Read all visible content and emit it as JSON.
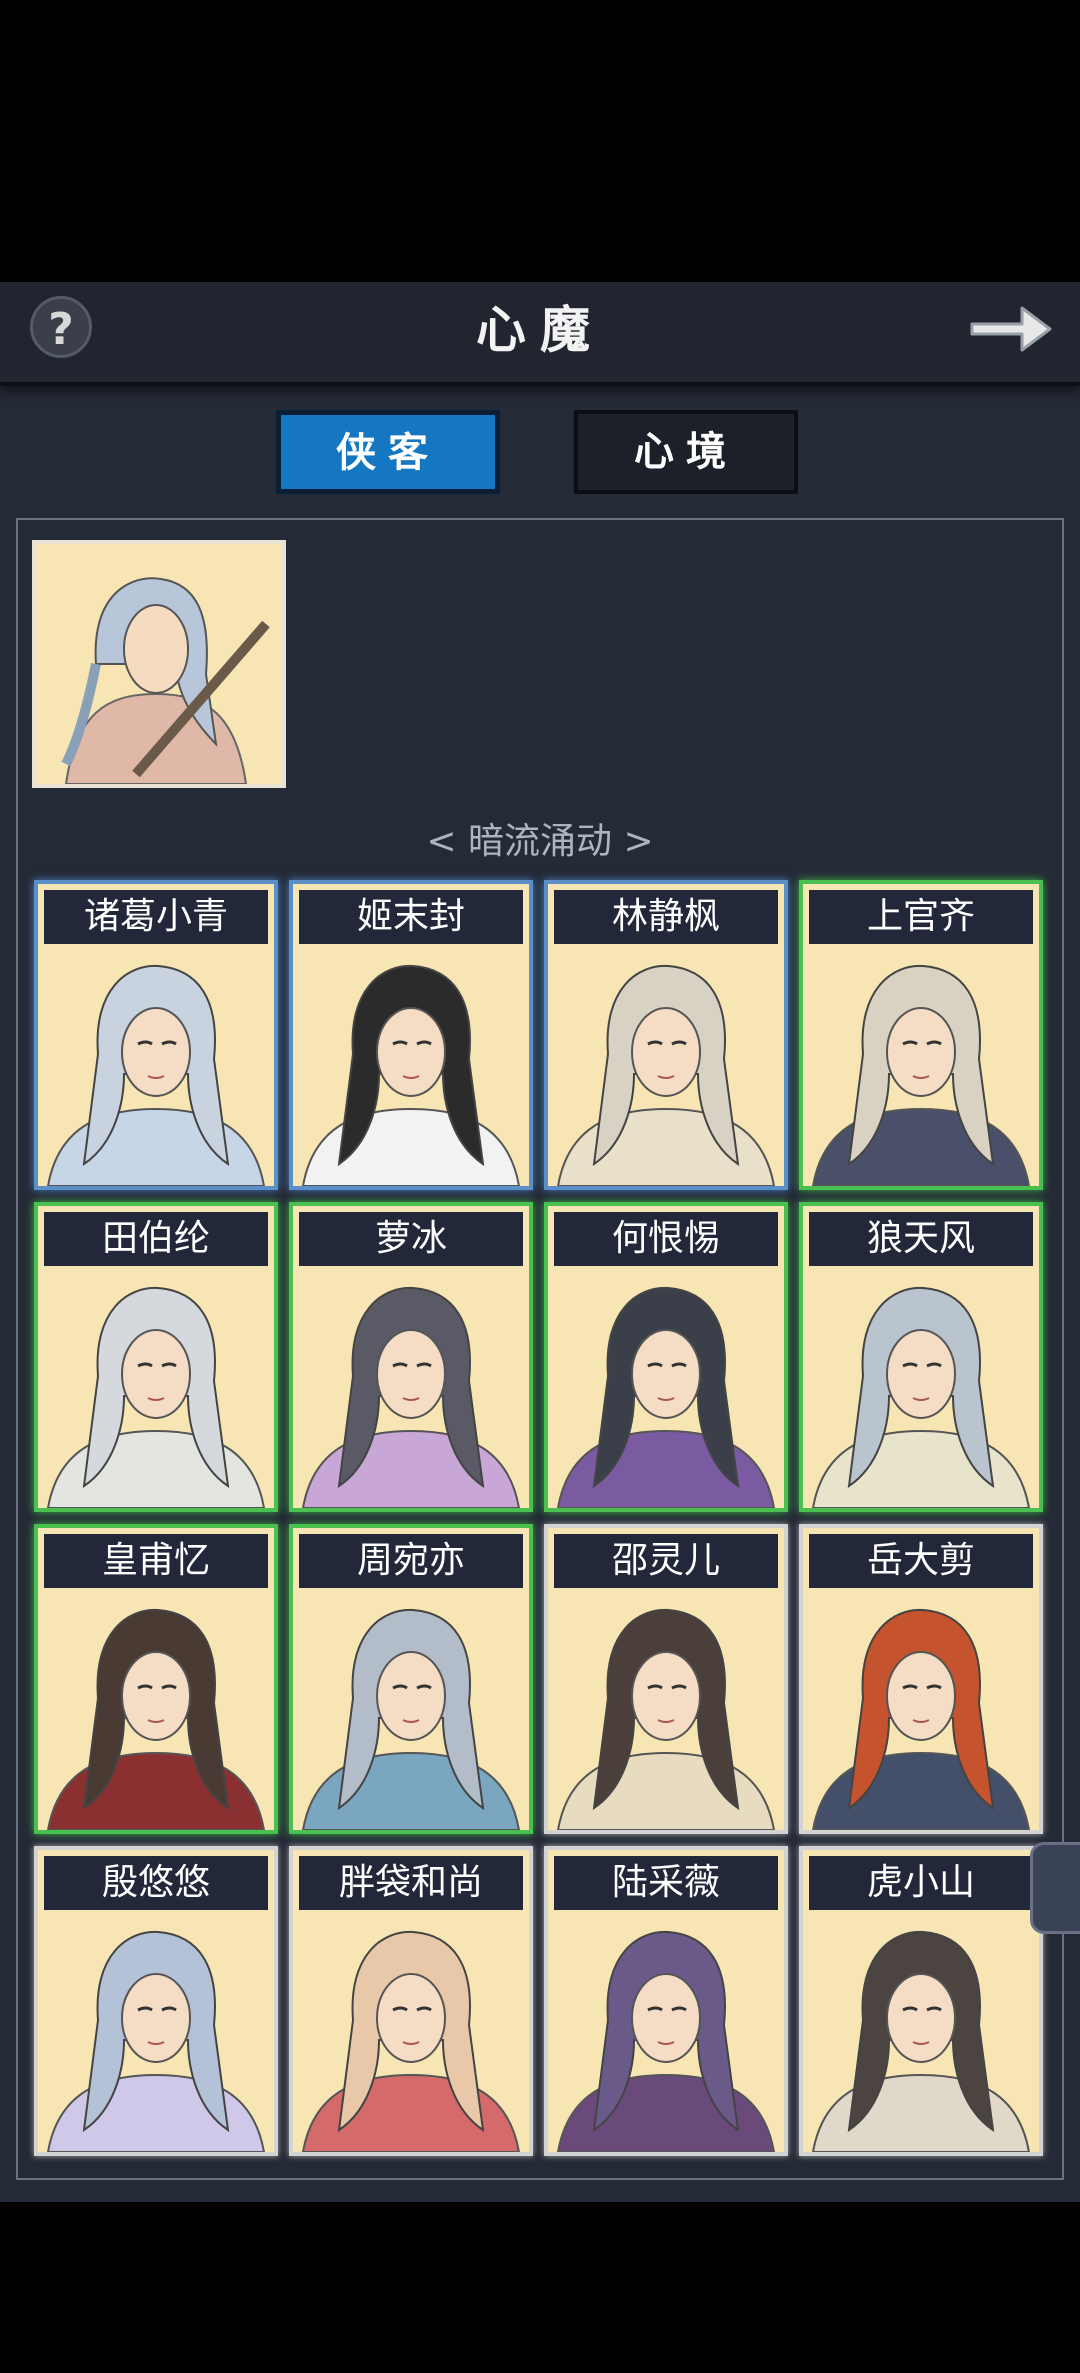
{
  "header": {
    "title": "心魔",
    "help_icon": "question-mark-icon",
    "back_icon": "arrow-right-icon"
  },
  "tabs": [
    {
      "label": "侠客",
      "active": true
    },
    {
      "label": "心境",
      "active": false
    }
  ],
  "section_label": "< 暗流涌动 >",
  "characters": [
    {
      "name": "诸葛小青",
      "rarity": "blue"
    },
    {
      "name": "姬末封",
      "rarity": "blue"
    },
    {
      "name": "林静枫",
      "rarity": "blue"
    },
    {
      "name": "上官齐",
      "rarity": "green"
    },
    {
      "name": "田伯纶",
      "rarity": "green"
    },
    {
      "name": "萝冰",
      "rarity": "green"
    },
    {
      "name": "何恨惕",
      "rarity": "green"
    },
    {
      "name": "狼天风",
      "rarity": "green"
    },
    {
      "name": "皇甫忆",
      "rarity": "green"
    },
    {
      "name": "周宛亦",
      "rarity": "green"
    },
    {
      "name": "邵灵儿",
      "rarity": "gray"
    },
    {
      "name": "岳大剪",
      "rarity": "gray"
    },
    {
      "name": "殷悠悠",
      "rarity": "gray"
    },
    {
      "name": "胖袋和尚",
      "rarity": "gray"
    },
    {
      "name": "陆采薇",
      "rarity": "gray"
    },
    {
      "name": "虎小山",
      "rarity": "gray"
    }
  ],
  "colors": {
    "blue_frame": "#5b8fc7",
    "green_frame": "#49c04f",
    "gray_frame": "#d3d3d3",
    "active_tab": "#1577c2",
    "portrait_bg": "#f7e6b4"
  }
}
